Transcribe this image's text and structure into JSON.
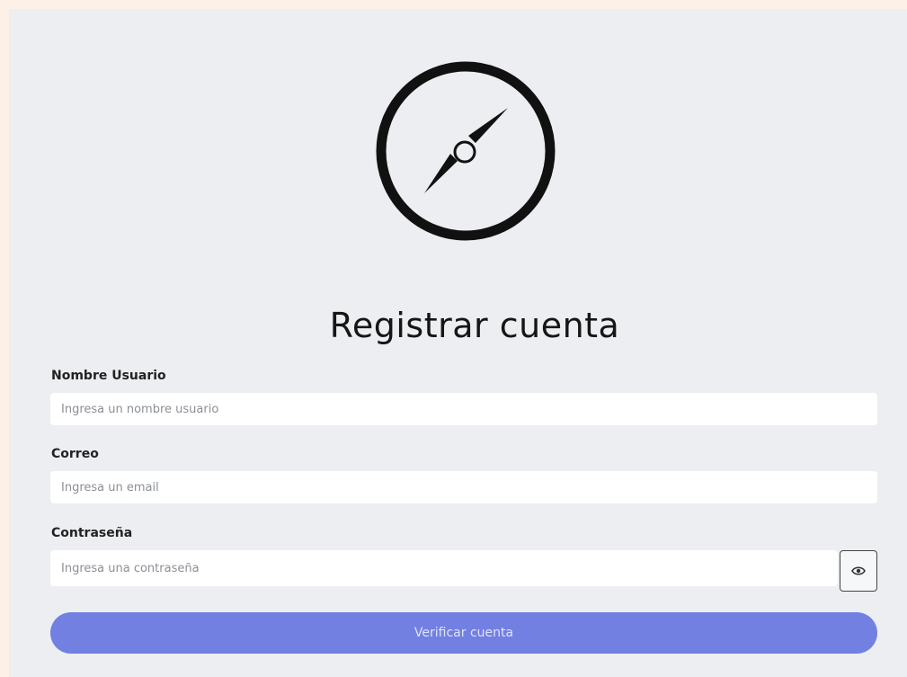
{
  "icons": {
    "logo": "compass-icon",
    "password_toggle": "eye-icon"
  },
  "form": {
    "title": "Registrar cuenta",
    "username": {
      "label": "Nombre Usuario",
      "placeholder": "Ingresa un nombre usuario",
      "value": ""
    },
    "email": {
      "label": "Correo",
      "placeholder": "Ingresa un email",
      "value": ""
    },
    "password": {
      "label": "Contraseña",
      "placeholder": "Ingresa una contraseña",
      "value": ""
    },
    "submit_label": "Verificar cuenta"
  },
  "colors": {
    "page_background": "#fdf1e7",
    "card_background": "#eceef1",
    "primary_button": "#7180e1",
    "primary_button_text": "#dfe3ff"
  }
}
